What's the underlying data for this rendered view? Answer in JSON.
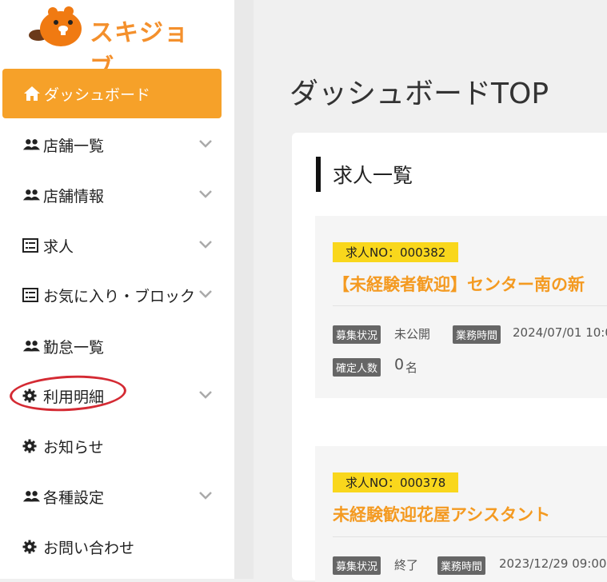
{
  "brand": {
    "name": "スキジョブ",
    "color": "#f4902c"
  },
  "sidebar": {
    "active": {
      "label": "ダッシュボード",
      "icon": "home-icon"
    },
    "items": [
      {
        "label": "店舗一覧",
        "icon": "users-icon"
      },
      {
        "label": "店舗情報",
        "icon": "users-icon"
      },
      {
        "label": "求人",
        "icon": "list-icon"
      },
      {
        "label": "お気に入り・ブロック",
        "icon": "list-icon"
      },
      {
        "label": "勤怠一覧",
        "icon": "users-icon"
      },
      {
        "label": "利用明細",
        "icon": "gear-icon"
      },
      {
        "label": "お知らせ",
        "icon": "gear-icon"
      },
      {
        "label": "各種設定",
        "icon": "users-icon"
      },
      {
        "label": "お問い合わせ",
        "icon": "gear-icon"
      }
    ]
  },
  "main": {
    "page_title": "ダッシュボードTOP",
    "panel_title": "求人一覧",
    "jobs": [
      {
        "job_no": "求人NO：000382",
        "title": "【未経験者歓迎】センター南の新",
        "status_label": "募集状況",
        "status_value": "未公開",
        "hours_label": "業務時間",
        "hours_value": "2024/07/01 10:0",
        "confirmed_label": "確定人数",
        "confirmed_count": "0",
        "confirmed_unit": "名"
      },
      {
        "job_no": "求人NO：000378",
        "title": "未経験歓迎花屋アシスタント",
        "status_label": "募集状況",
        "status_value": "終了",
        "hours_label": "業務時間",
        "hours_value": "2023/12/29 09:00-"
      }
    ]
  },
  "colors": {
    "accent": "#f6a129",
    "badge": "#f9d71c",
    "highlight": "#d42a33"
  }
}
